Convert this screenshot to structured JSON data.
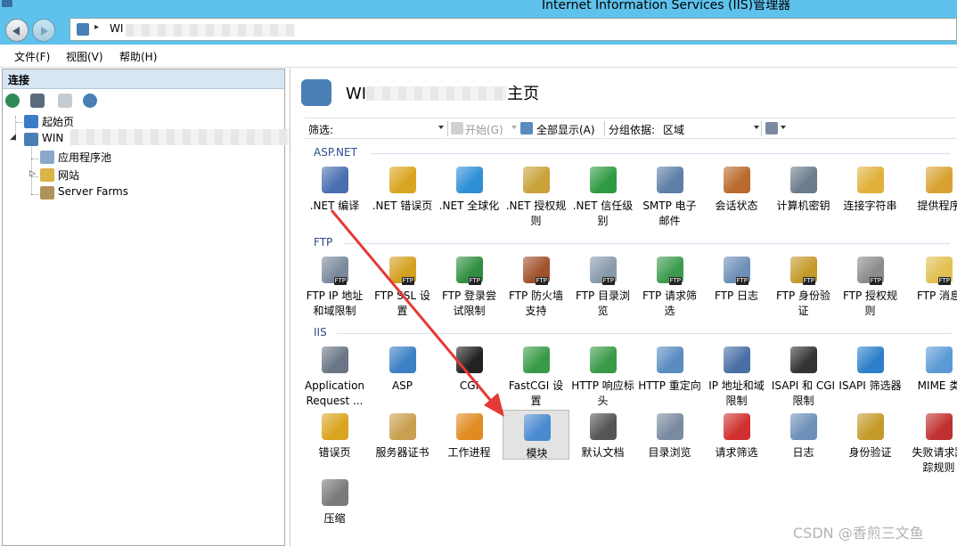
{
  "window": {
    "title": "Internet Information Services (IIS)管理器"
  },
  "address": {
    "path_prefix": "WI",
    "separator": "▸"
  },
  "menu": {
    "file": "文件(F)",
    "view": "视图(V)",
    "help": "帮助(H)"
  },
  "connections": {
    "header": "连接",
    "tree": {
      "start_page": "起始页",
      "server": "WIN",
      "app_pools": "应用程序池",
      "sites": "网站",
      "server_farms": "Server Farms"
    }
  },
  "page": {
    "title_prefix": "WI",
    "title_suffix": "主页",
    "filter": {
      "label": "筛选:",
      "go": "开始(G)",
      "show_all": "全部显示(A)",
      "group_by_label": "分组依据:",
      "group_by_value": "区域"
    }
  },
  "groups": {
    "aspnet": {
      "title": "ASP.NET",
      "items": [
        {
          "label": ".NET 编译",
          "icon": "compile-icon",
          "color": "#4a6fb0"
        },
        {
          "label": ".NET 错误页",
          "icon": "error-page-icon",
          "color": "#d9a520"
        },
        {
          "label": ".NET 全球化",
          "icon": "globe-icon",
          "color": "#2d8fd6"
        },
        {
          "label": ".NET 授权规\n则",
          "icon": "auth-rules-icon",
          "color": "#c9a23a"
        },
        {
          "label": ".NET 信任级\n别",
          "icon": "trust-icon",
          "color": "#2e9b42"
        },
        {
          "label": "SMTP 电子\n邮件",
          "icon": "smtp-icon",
          "color": "#5d7fa8"
        },
        {
          "label": "会话状态",
          "icon": "session-icon",
          "color": "#b96a2c"
        },
        {
          "label": "计算机密钥",
          "icon": "machine-key-icon",
          "color": "#6b7b8c"
        },
        {
          "label": "连接字符串",
          "icon": "connection-string-icon",
          "color": "#e0b03a"
        },
        {
          "label": "提供程序",
          "icon": "providers-icon",
          "color": "#d8a232"
        }
      ]
    },
    "ftp": {
      "title": "FTP",
      "items": [
        {
          "label": "FTP IP 地址\n和域限制",
          "icon": "ftp-ip-icon",
          "color": "#7a8a9c"
        },
        {
          "label": "FTP SSL 设\n置",
          "icon": "ftp-ssl-icon",
          "color": "#d4a020"
        },
        {
          "label": "FTP 登录尝\n试限制",
          "icon": "ftp-logon-icon",
          "color": "#2f8e3f"
        },
        {
          "label": "FTP 防火墙\n支持",
          "icon": "ftp-firewall-icon",
          "color": "#a0522d"
        },
        {
          "label": "FTP 目录浏\n览",
          "icon": "ftp-browse-icon",
          "color": "#8a9aad"
        },
        {
          "label": "FTP 请求筛\n选",
          "icon": "ftp-filter-icon",
          "color": "#3d9a4d"
        },
        {
          "label": "FTP 日志",
          "icon": "ftp-log-icon",
          "color": "#6d8fb8"
        },
        {
          "label": "FTP 身份验\n证",
          "icon": "ftp-authn-icon",
          "color": "#c49a2a"
        },
        {
          "label": "FTP 授权规\n则",
          "icon": "ftp-authz-icon",
          "color": "#8c8c8c"
        },
        {
          "label": "FTP 消息",
          "icon": "ftp-message-icon",
          "color": "#e0c050"
        }
      ]
    },
    "iis": {
      "title": "IIS",
      "items": [
        {
          "label": "Application\nRequest ...",
          "icon": "arr-icon",
          "color": "#6a7686"
        },
        {
          "label": "ASP",
          "icon": "asp-icon",
          "color": "#3b7fc4"
        },
        {
          "label": "CGI",
          "icon": "cgi-icon",
          "color": "#222222"
        },
        {
          "label": "FastCGI 设\n置",
          "icon": "fastcgi-icon",
          "color": "#3a9a48"
        },
        {
          "label": "HTTP 响应标\n头",
          "icon": "http-headers-icon",
          "color": "#3a9a48"
        },
        {
          "label": "HTTP 重定向",
          "icon": "http-redirect-icon",
          "color": "#5a8cc0"
        },
        {
          "label": "IP 地址和域\n限制",
          "icon": "ip-domain-icon",
          "color": "#4a6fa5"
        },
        {
          "label": "ISAPI 和 CGI\n限制",
          "icon": "isapi-cgi-icon",
          "color": "#333333"
        },
        {
          "label": "ISAPI 筛选器",
          "icon": "isapi-filter-icon",
          "color": "#2d7fc9"
        },
        {
          "label": "MIME 类",
          "icon": "mime-icon",
          "color": "#5b9bd5"
        },
        {
          "label": "错误页",
          "icon": "error-pages-icon",
          "color": "#d9a520"
        },
        {
          "label": "服务器证书",
          "icon": "certificate-icon",
          "color": "#c8a050"
        },
        {
          "label": "工作进程",
          "icon": "worker-process-icon",
          "color": "#e08a20"
        },
        {
          "label": "模块",
          "icon": "modules-icon",
          "color": "#4a8ad0"
        },
        {
          "label": "默认文档",
          "icon": "default-doc-icon",
          "color": "#555555"
        },
        {
          "label": "目录浏览",
          "icon": "dir-browse-icon",
          "color": "#7a8aa0"
        },
        {
          "label": "请求筛选",
          "icon": "request-filter-icon",
          "color": "#d03030"
        },
        {
          "label": "日志",
          "icon": "logging-icon",
          "color": "#6d8fb8"
        },
        {
          "label": "身份验证",
          "icon": "authentication-icon",
          "color": "#c49a2a"
        },
        {
          "label": "失败请求跟\n踪规则",
          "icon": "failed-request-icon",
          "color": "#c03030"
        },
        {
          "label": "压缩",
          "icon": "compression-icon",
          "color": "#7a7a7a"
        }
      ]
    }
  },
  "watermark": "CSDN @香煎三文鱼",
  "colors": {
    "titlebar": "#5fc2ec",
    "annotation_arrow": "#e53935",
    "group_title": "#2a4b8d"
  }
}
